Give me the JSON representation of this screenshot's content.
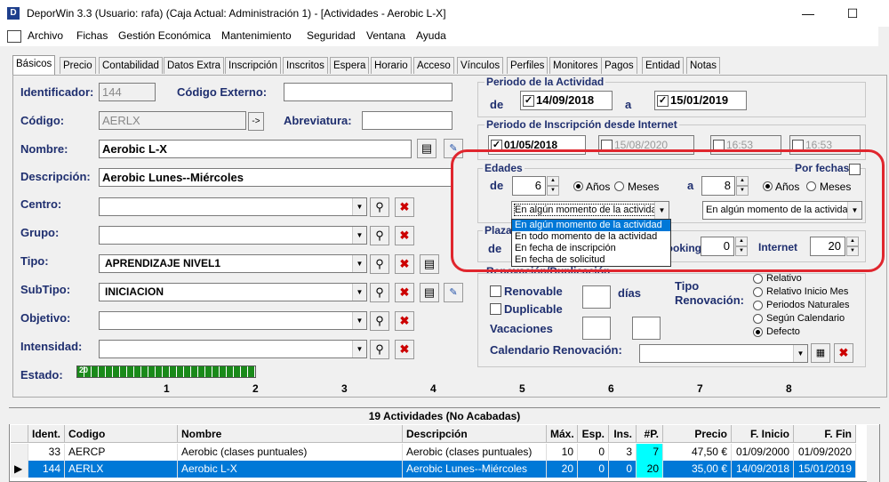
{
  "window": {
    "title": "DeporWin 3.3  (Usuario: rafa)  (Caja Actual: Administración 1) - [Actividades - Aerobic L-X]",
    "app_icon": "D",
    "minimize": "—",
    "maximize": "☐"
  },
  "menu": [
    "Archivo",
    "Fichas",
    "Gestión Económica",
    "Mantenimiento",
    "Seguridad",
    "Ventana",
    "Ayuda"
  ],
  "tabs": [
    "Básicos",
    "Precio",
    "Contabilidad",
    "Datos Extra",
    "Inscripción",
    "Inscritos",
    "Espera",
    "Horario",
    "Acceso",
    "Vínculos",
    "Perfiles",
    "Monitores",
    "Pagos",
    "Entidad",
    "Notas"
  ],
  "form": {
    "identificador_label": "Identificador:",
    "identificador": "144",
    "codigo_externo_label": "Código Externo:",
    "codigo_externo": "",
    "codigo_label": "Código:",
    "codigo": "AERLX",
    "codigo_btn": "->",
    "abreviatura_label": "Abreviatura:",
    "abreviatura": "",
    "nombre_label": "Nombre:",
    "nombre": "Aerobic L-X",
    "descripcion_label": "Descripción:",
    "descripcion": "Aerobic Lunes--Miércoles",
    "centro_label": "Centro:",
    "centro": "",
    "grupo_label": "Grupo:",
    "grupo": "",
    "tipo_label": "Tipo:",
    "tipo": "APRENDIZAJE NIVEL1",
    "subtipo_label": "SubTipo:",
    "subtipo": "INICIACION",
    "objetivo_label": "Objetivo:",
    "objetivo": "",
    "intensidad_label": "Intensidad:",
    "intensidad": "",
    "estado_label": "Estado:",
    "estado_value": "20",
    "estado_ticks": [
      "1",
      "2",
      "3",
      "4",
      "5",
      "6",
      "7",
      "8"
    ]
  },
  "periodo": {
    "title": "Periodo de la Actividad",
    "de": "de",
    "a": "a",
    "desde": "14/09/2018",
    "hasta": "15/01/2019"
  },
  "inscripcion": {
    "title": "Periodo de Inscripción desde Internet",
    "desde": "01/05/2018",
    "hasta": "15/08/2020",
    "hora1": "16:53",
    "hora2": "16:53"
  },
  "edades": {
    "title": "Edades",
    "por_fechas": "Por fechas",
    "de": "de",
    "a": "a",
    "desde": "6",
    "hasta": "8",
    "anios": "Años",
    "meses": "Meses",
    "combo1": "En algún momento de la actividad",
    "combo2": "En algún momento de la actividad",
    "options": [
      "En algún momento de la actividad",
      "En todo momento de la actividad",
      "En fecha de inscripción",
      "En fecha de solicitud"
    ]
  },
  "plazas": {
    "title": "Plazas",
    "de": "de",
    "booking_label": "Booking",
    "booking": "0",
    "internet_label": "Internet",
    "internet": "20"
  },
  "renovacion": {
    "title": "Renovación/Duplicación",
    "renovable": "Renovable",
    "duplicable": "Duplicable",
    "dias": "días",
    "vacaciones": "Vacaciones",
    "tipo_label": "Tipo Renovación:",
    "tipo_label_1": "Tipo",
    "tipo_label_2": "Renovación:",
    "calendario_label": "Calendario Renovación:",
    "options": [
      "Relativo",
      "Relativo Inicio Mes",
      "Periodos Naturales",
      "Según Calendario",
      "Defecto"
    ],
    "selected": "Defecto"
  },
  "grid": {
    "title": "19 Actividades  (No Acabadas)",
    "columns": [
      "Ident.",
      "Codigo",
      "Nombre",
      "Descripción",
      "Máx.",
      "Esp.",
      "Ins.",
      "#P.",
      "Precio",
      "F. Inicio",
      "F. Fin"
    ],
    "rows": [
      [
        "33",
        "AERCP",
        "Aerobic (clases puntuales)",
        "Aerobic (clases puntuales)",
        "10",
        "0",
        "3",
        "7",
        "47,50 €",
        "01/09/2000",
        "01/09/2020"
      ],
      [
        "144",
        "AERLX",
        "Aerobic L-X",
        "Aerobic Lunes--Miércoles",
        "20",
        "0",
        "0",
        "20",
        "35,00 €",
        "14/09/2018",
        "15/01/2019"
      ]
    ]
  },
  "colors": {
    "highlight": "#e0262e",
    "selection": "#0078d7",
    "label": "#1f2f6f",
    "state_bar": "#1a8a1a"
  }
}
